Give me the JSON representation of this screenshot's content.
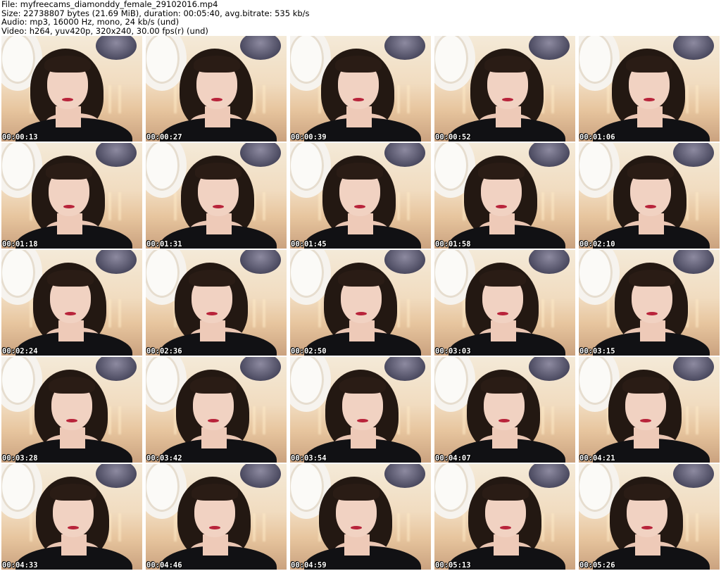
{
  "header": {
    "file_line": "File: myfreecams_diamonddy_female_29102016.mp4",
    "size_line": "Size: 22738807 bytes (21.69 MiB), duration: 00:05:40, avg.bitrate: 535 kb/s",
    "audio_line": "Audio: mp3, 16000 Hz, mono, 24 kb/s (und)",
    "video_line": "Video: h264, yuv420p, 320x240, 30.00 fps(r) (und)"
  },
  "thumbnails": [
    {
      "timestamp": "00:00:13"
    },
    {
      "timestamp": "00:00:27"
    },
    {
      "timestamp": "00:00:39"
    },
    {
      "timestamp": "00:00:52"
    },
    {
      "timestamp": "00:01:06"
    },
    {
      "timestamp": "00:01:18"
    },
    {
      "timestamp": "00:01:31"
    },
    {
      "timestamp": "00:01:45"
    },
    {
      "timestamp": "00:01:58"
    },
    {
      "timestamp": "00:02:10"
    },
    {
      "timestamp": "00:02:24"
    },
    {
      "timestamp": "00:02:36"
    },
    {
      "timestamp": "00:02:50"
    },
    {
      "timestamp": "00:03:03"
    },
    {
      "timestamp": "00:03:15"
    },
    {
      "timestamp": "00:03:28"
    },
    {
      "timestamp": "00:03:42"
    },
    {
      "timestamp": "00:03:54"
    },
    {
      "timestamp": "00:04:07"
    },
    {
      "timestamp": "00:04:21"
    },
    {
      "timestamp": "00:04:33"
    },
    {
      "timestamp": "00:04:46"
    },
    {
      "timestamp": "00:04:59"
    },
    {
      "timestamp": "00:05:13"
    },
    {
      "timestamp": "00:05:26"
    }
  ],
  "colors": {
    "timestamp_text": "#ffffff",
    "timestamp_outline": "#000000",
    "background": "#ffffff"
  }
}
